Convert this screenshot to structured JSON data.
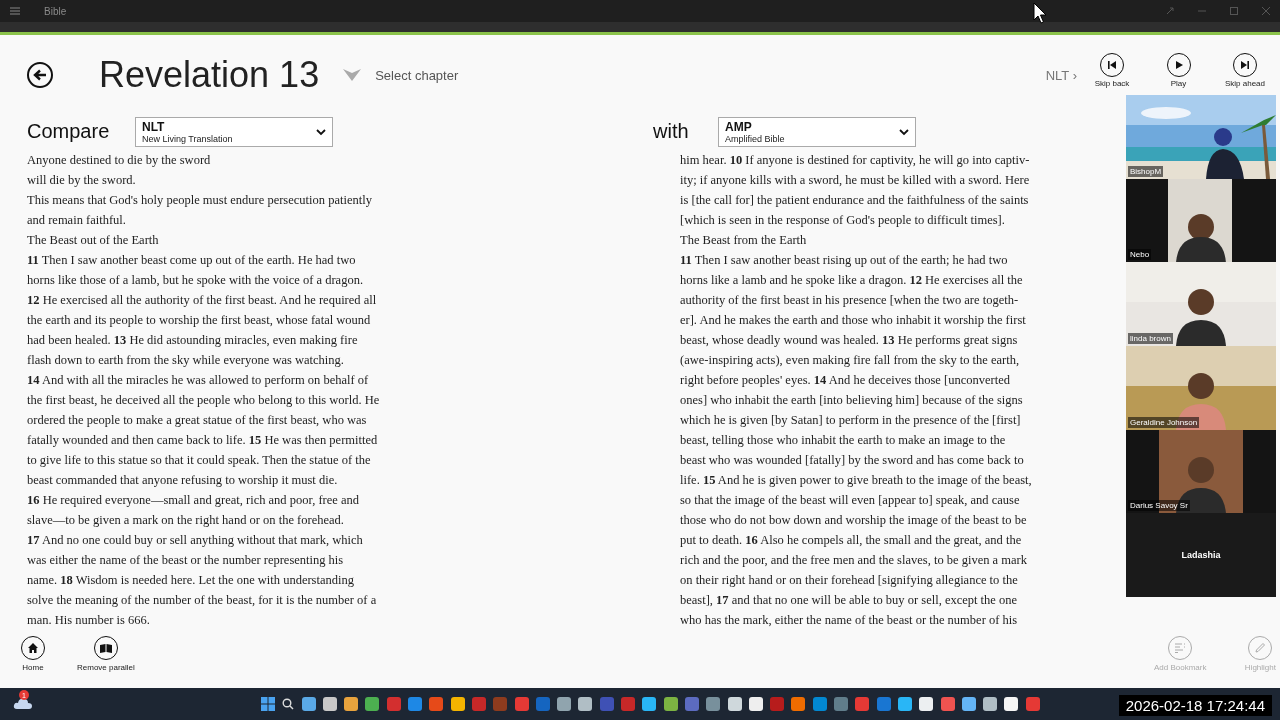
{
  "window": {
    "title": "Bible"
  },
  "header": {
    "title": "Revelation 13",
    "chapter_picker": "Select chapter",
    "version_link": "NLT ›",
    "media": [
      {
        "kind": "skip-back",
        "label": "Skip back"
      },
      {
        "kind": "play",
        "label": "Play"
      },
      {
        "kind": "skip-ahead",
        "label": "Skip ahead"
      }
    ]
  },
  "compare": {
    "label": "Compare",
    "version": {
      "code": "NLT",
      "name": "New Living Translation"
    }
  },
  "with": {
    "label": "with",
    "version": {
      "code": "AMP",
      "name": "Amplified Bible"
    }
  },
  "left_text": [
    "Anyone destined to die by the sword",
    "will die by the sword.",
    "This means that God's holy people must endure persecution patiently",
    "and remain faithful.",
    "The Beast out of the Earth",
    "**11** Then I saw another beast come up out of the earth. He had two",
    "horns like those of a lamb, but he spoke with the voice of a dragon.",
    "**12** He exercised all the authority of the first beast. And he required all",
    "the earth and its people to worship the first beast, whose fatal wound",
    "had been healed. **13** He did astounding miracles, even making fire",
    "flash down to earth from the sky while everyone was watching.",
    "**14** And with all the miracles he was allowed to perform on behalf of",
    "the first beast, he deceived all the people who belong to this world. He",
    "ordered the people to make a great statue of the first beast, who was",
    "fatally wounded and then came back to life. **15** He was then permitted",
    "to give life to this statue so that it could speak. Then the statue of the",
    "beast commanded that anyone refusing to worship it must die.",
    "**16** He required everyone—small and great, rich and poor, free and",
    "slave—to be given a mark on the right hand or on the forehead.",
    "**17** And no one could buy or sell anything without that mark, which",
    "was either the name of the beast or the number representing his",
    "name. **18** Wisdom is needed here. Let the one with understanding",
    "solve the meaning of the number of the beast, for it is the number of a",
    "man. His number is 666."
  ],
  "right_text": [
    "him hear. **10** If anyone is destined for captivity, he will go into captiv-",
    "ity; if anyone kills with a sword, he must be killed with a sword. Here",
    "is [the call for] the patient endurance and the faithfulness of the saints",
    "[which is seen in the response of God's people to difficult times].",
    "The Beast from the Earth",
    "**11** Then I saw another beast rising up out of the earth; he had two",
    "horns like a lamb and he spoke like a dragon. **12** He exercises all the",
    "authority of the first beast in his presence [when the two are togeth-",
    "er]. And he makes the earth and those who inhabit it worship the first",
    "beast, whose deadly wound was healed. **13** He performs great signs",
    "(awe-inspiring acts), even making fire fall from the sky to the earth,",
    "right before peoples' eyes. **14** And he deceives those [unconverted",
    "ones] who inhabit the earth [into believing him] because of the signs",
    "which he is given [by Satan] to perform in the presence of the [first]",
    "beast, telling those who inhabit the earth to make an image to the",
    "beast who was wounded [fatally] by the sword and has come back to",
    "life. **15** And he is given power to give breath to the image of the beast,",
    "so that the image of the beast will even [appear to] speak, and cause",
    "those who do not bow down and worship the image of the beast to be",
    "put to death. **16** Also he compels all, the small and the great, and the",
    "rich and the poor, and the free men and the slaves, to be given a mark",
    "on their right hand or on their forehead [signifying allegiance to the",
    "beast], **17** and that no one will be able to buy or sell, except the one",
    "who has the mark, either the name of the beast or the number of his"
  ],
  "participants": [
    {
      "name": "BishopM",
      "kind": "video"
    },
    {
      "name": "Nebo",
      "kind": "video"
    },
    {
      "name": "linda brown",
      "kind": "video"
    },
    {
      "name": "Geraldine Johnson",
      "kind": "video"
    },
    {
      "name": "Darius Savoy Sr",
      "kind": "video"
    },
    {
      "name": "Ladashia",
      "kind": "name-only"
    }
  ],
  "bottom_bar": {
    "left": [
      {
        "kind": "home",
        "label": "Home",
        "disabled": false
      },
      {
        "kind": "parallel",
        "label": "Remove parallel",
        "disabled": false
      }
    ],
    "right": [
      {
        "kind": "bookmark",
        "label": "Add Bookmark",
        "disabled": true
      },
      {
        "kind": "highlight",
        "label": "Highlight",
        "disabled": true
      }
    ]
  },
  "taskbar": {
    "badge": "1",
    "timestamp": "2026-02-18 17:24:44"
  }
}
